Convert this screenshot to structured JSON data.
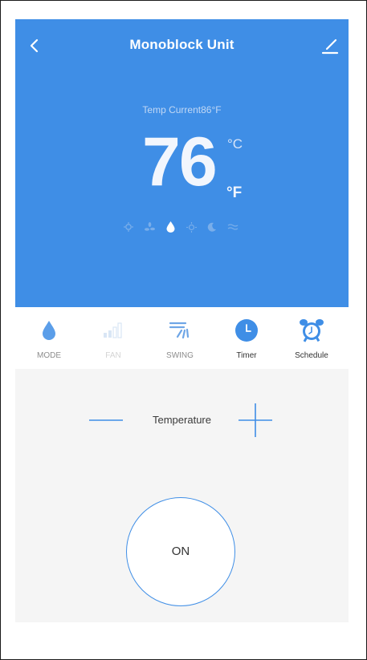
{
  "header": {
    "title": "Monoblock Unit",
    "back_icon": "chevron-left-icon",
    "edit_icon": "pencil-icon",
    "background_color": "#3f8ee6"
  },
  "display": {
    "current_temp_text": "Temp Current86°F",
    "set_temp": "76",
    "unit_c": "°C",
    "unit_f": "°F",
    "mode_icons": [
      "auto-icon",
      "fan-icon",
      "dry-icon",
      "heat-icon",
      "sleep-icon",
      "eco-icon"
    ],
    "active_mode_icon": "dry-icon"
  },
  "functions": [
    {
      "label": "MODE",
      "icon": "water-drop-icon",
      "enabled": true
    },
    {
      "label": "FAN",
      "icon": "fan-speed-bars-icon",
      "enabled": false
    },
    {
      "label": "SWING",
      "icon": "swing-icon",
      "enabled": true
    },
    {
      "label": "Timer",
      "icon": "clock-icon",
      "enabled": true
    },
    {
      "label": "Schedule",
      "icon": "alarm-clock-icon",
      "enabled": true
    }
  ],
  "controls": {
    "temperature_label": "Temperature",
    "power_label": "ON",
    "accent_color": "#3f8ee6"
  }
}
